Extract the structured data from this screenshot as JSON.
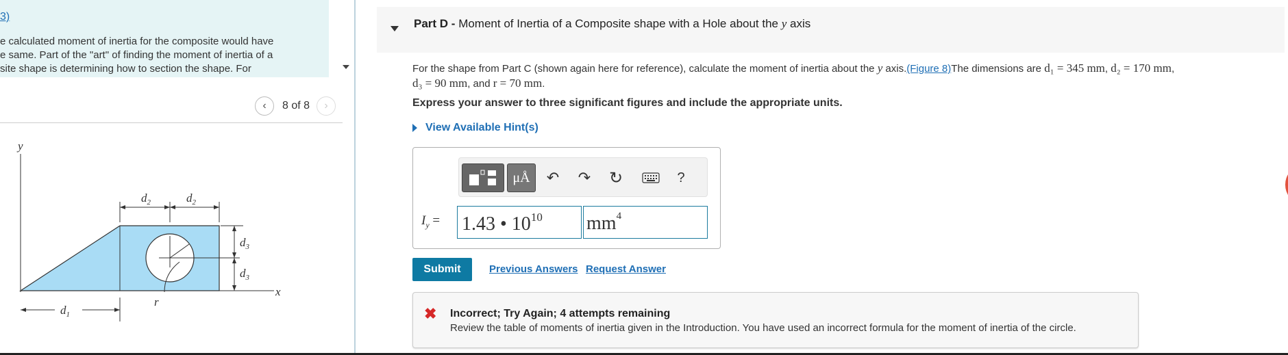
{
  "intro": {
    "link_text": "3)",
    "line1": "e calculated moment of inertia for the composite would have",
    "line2": "e same. Part of the \"art\" of finding the moment of inertia of a",
    "line3": "site shape is determining how to section the shape. For"
  },
  "figure_nav": {
    "prev_icon": "‹",
    "counter": "8 of 8",
    "next_icon": "›"
  },
  "figure": {
    "label_y": "y",
    "label_x": "x",
    "label_d1": "d",
    "label_d1_sub": "1",
    "label_d2a": "d",
    "label_d2a_sub": "2",
    "label_d2b": "d",
    "label_d2b_sub": "2",
    "label_d3a": "d",
    "label_d3a_sub": "3",
    "label_d3b": "d",
    "label_d3b_sub": "3",
    "label_r": "r",
    "fill_color": "#a9dcf5"
  },
  "part": {
    "prefix": "Part D -",
    "title": " Moment of Inertia of a Composite shape with a Hole about the ",
    "title_var": "y",
    "title_suffix": " axis"
  },
  "question": {
    "text1": "For the shape from Part C (shown again here for reference), calculate the  moment of inertia about the ",
    "var_y": "y",
    "text2": " axis.",
    "figure_link": "(Figure 8)",
    "text3": "The dimensions are ",
    "d1_eq": "d₁ = 345 mm",
    "sep1": ", ",
    "d2_eq": "d₂ = 170 mm",
    "sep2": ",",
    "d3_eq": "d₃ = 90 mm",
    "sep3": ", and ",
    "r_eq": "r = 70 mm",
    "end": "."
  },
  "instructions": "Express your answer to three significant figures and include the appropriate units.",
  "hints_label": "View Available Hint(s)",
  "toolbar": {
    "units_label": "μÅ",
    "undo_icon": "↶",
    "redo_icon": "↷",
    "reset_icon": "↻",
    "help_label": "?"
  },
  "answer": {
    "label": "I",
    "label_sub": "y",
    "label_eq": " =",
    "value_mantissa": "1.43 • 10",
    "value_exponent": "10",
    "unit": "mm",
    "unit_exponent": "4"
  },
  "actions": {
    "submit": "Submit",
    "previous_answers": "Previous Answers",
    "request_answer": "Request Answer"
  },
  "feedback": {
    "icon": "✖",
    "title": "Incorrect; Try Again; 4 attempts remaining",
    "text": "Review the table of moments of inertia given in the Introduction. You have used an incorrect formula for the moment of inertia of the circle."
  },
  "colors": {
    "accent": "#0e7aa3",
    "link": "#1f6fb5",
    "error": "#d62828",
    "intro_bg": "#e5f4f5"
  }
}
